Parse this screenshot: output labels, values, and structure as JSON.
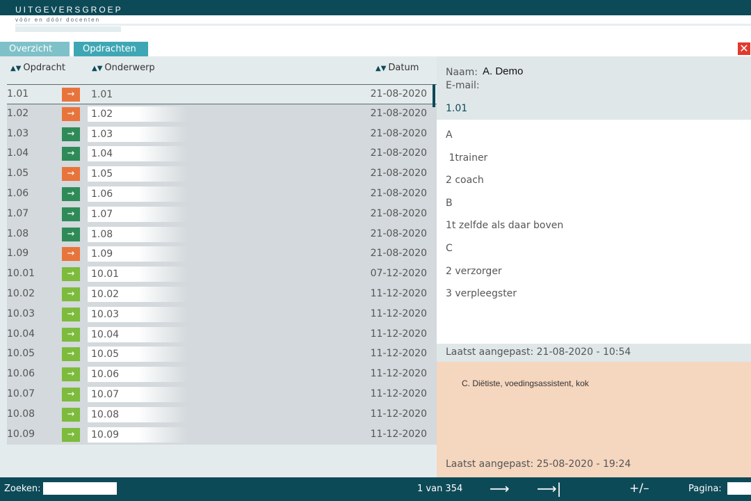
{
  "brand": {
    "name": "UITGEVERSGROEP",
    "tagline": "vóór en dóór docenten"
  },
  "tabs": [
    {
      "label": "Overzicht"
    },
    {
      "label": "Opdrachten"
    }
  ],
  "close": {
    "icon": "close-icon",
    "glyph": "✕"
  },
  "table": {
    "headers": {
      "opdracht": "Opdracht",
      "onderwerp": "Onderwerp",
      "datum": "Datum"
    },
    "sort_icon": "sort-icon",
    "rows": [
      {
        "code": "1.01",
        "subject": "1.01",
        "date": "21-08-2020",
        "status": "orange",
        "selected": true
      },
      {
        "code": "1.02",
        "subject": "1.02",
        "date": "21-08-2020",
        "status": "orange"
      },
      {
        "code": "1.03",
        "subject": "1.03",
        "date": "21-08-2020",
        "status": "dark-green"
      },
      {
        "code": "1.04",
        "subject": "1.04",
        "date": "21-08-2020",
        "status": "dark-green"
      },
      {
        "code": "1.05",
        "subject": "1.05",
        "date": "21-08-2020",
        "status": "orange"
      },
      {
        "code": "1.06",
        "subject": "1.06",
        "date": "21-08-2020",
        "status": "dark-green"
      },
      {
        "code": "1.07",
        "subject": "1.07",
        "date": "21-08-2020",
        "status": "dark-green"
      },
      {
        "code": "1.08",
        "subject": "1.08",
        "date": "21-08-2020",
        "status": "dark-green"
      },
      {
        "code": "1.09",
        "subject": "1.09",
        "date": "21-08-2020",
        "status": "orange"
      },
      {
        "code": "10.01",
        "subject": "10.01",
        "date": "07-12-2020",
        "status": "light-green"
      },
      {
        "code": "10.02",
        "subject": "10.02",
        "date": "11-12-2020",
        "status": "light-green"
      },
      {
        "code": "10.03",
        "subject": "10.03",
        "date": "11-12-2020",
        "status": "light-green"
      },
      {
        "code": "10.04",
        "subject": "10.04",
        "date": "11-12-2020",
        "status": "light-green"
      },
      {
        "code": "10.05",
        "subject": "10.05",
        "date": "11-12-2020",
        "status": "light-green"
      },
      {
        "code": "10.06",
        "subject": "10.06",
        "date": "11-12-2020",
        "status": "light-green"
      },
      {
        "code": "10.07",
        "subject": "10.07",
        "date": "11-12-2020",
        "status": "light-green"
      },
      {
        "code": "10.08",
        "subject": "10.08",
        "date": "11-12-2020",
        "status": "light-green"
      },
      {
        "code": "10.09",
        "subject": "10.09",
        "date": "11-12-2020",
        "status": "light-green"
      }
    ]
  },
  "status_colors": {
    "orange": "#e8743b",
    "dark-green": "#2e8b57",
    "light-green": "#7dbb3c"
  },
  "detail": {
    "naam_label": "Naam:",
    "naam_value": "A. Demo",
    "email_label": "E-mail:",
    "assignment_id": "1.01",
    "answer_lines": [
      "A",
      " 1trainer",
      "2 coach",
      "B",
      "1t zelfde als daar boven",
      "C",
      "2 verzorger",
      "3 verpleegster"
    ],
    "last_modified": "Laatst aangepast: 21-08-2020 - 10:54",
    "feedback_text": "C. Diëtiste, voedingsassistent, kok",
    "feedback_last_modified": "Laatst aangepast: 25-08-2020 - 19:24"
  },
  "footer": {
    "zoeken_label": "Zoeken:",
    "zoeken_value": "",
    "page_info": "1 van 354",
    "next_icon": "arrow-right-icon",
    "last_icon": "arrow-last-icon",
    "plusminus": "+/–",
    "pagina_label": "Pagina:",
    "pagina_value": ""
  }
}
